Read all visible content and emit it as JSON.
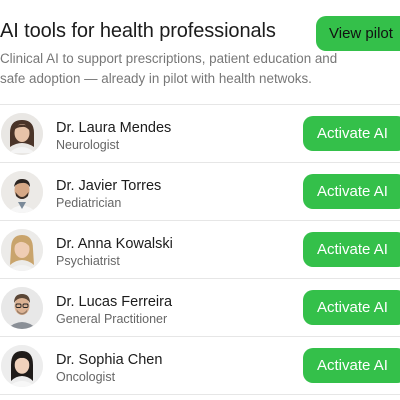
{
  "header": {
    "title": "AI tools for health professionals",
    "subtitle": "Clinical AI to support prescriptions, patient education and safe adoption — already in pilot with health netwoks.",
    "view_pilot_label": "View pilot"
  },
  "colors": {
    "accent_green": "#34c04a",
    "divider": "#e6e6e6"
  },
  "doctors": [
    {
      "name": "Dr. Laura Mendes",
      "role": "Neurologist",
      "action_label": "Activate AI"
    },
    {
      "name": "Dr. Javier Torres",
      "role": "Pediatrician",
      "action_label": "Activate AI"
    },
    {
      "name": "Dr. Anna Kowalski",
      "role": "Psychiatrist",
      "action_label": "Activate AI"
    },
    {
      "name": "Dr. Lucas Ferreira",
      "role": "General Practitioner",
      "action_label": "Activate AI"
    },
    {
      "name": "Dr. Sophia Chen",
      "role": "Oncologist",
      "action_label": "Activate AI"
    }
  ]
}
